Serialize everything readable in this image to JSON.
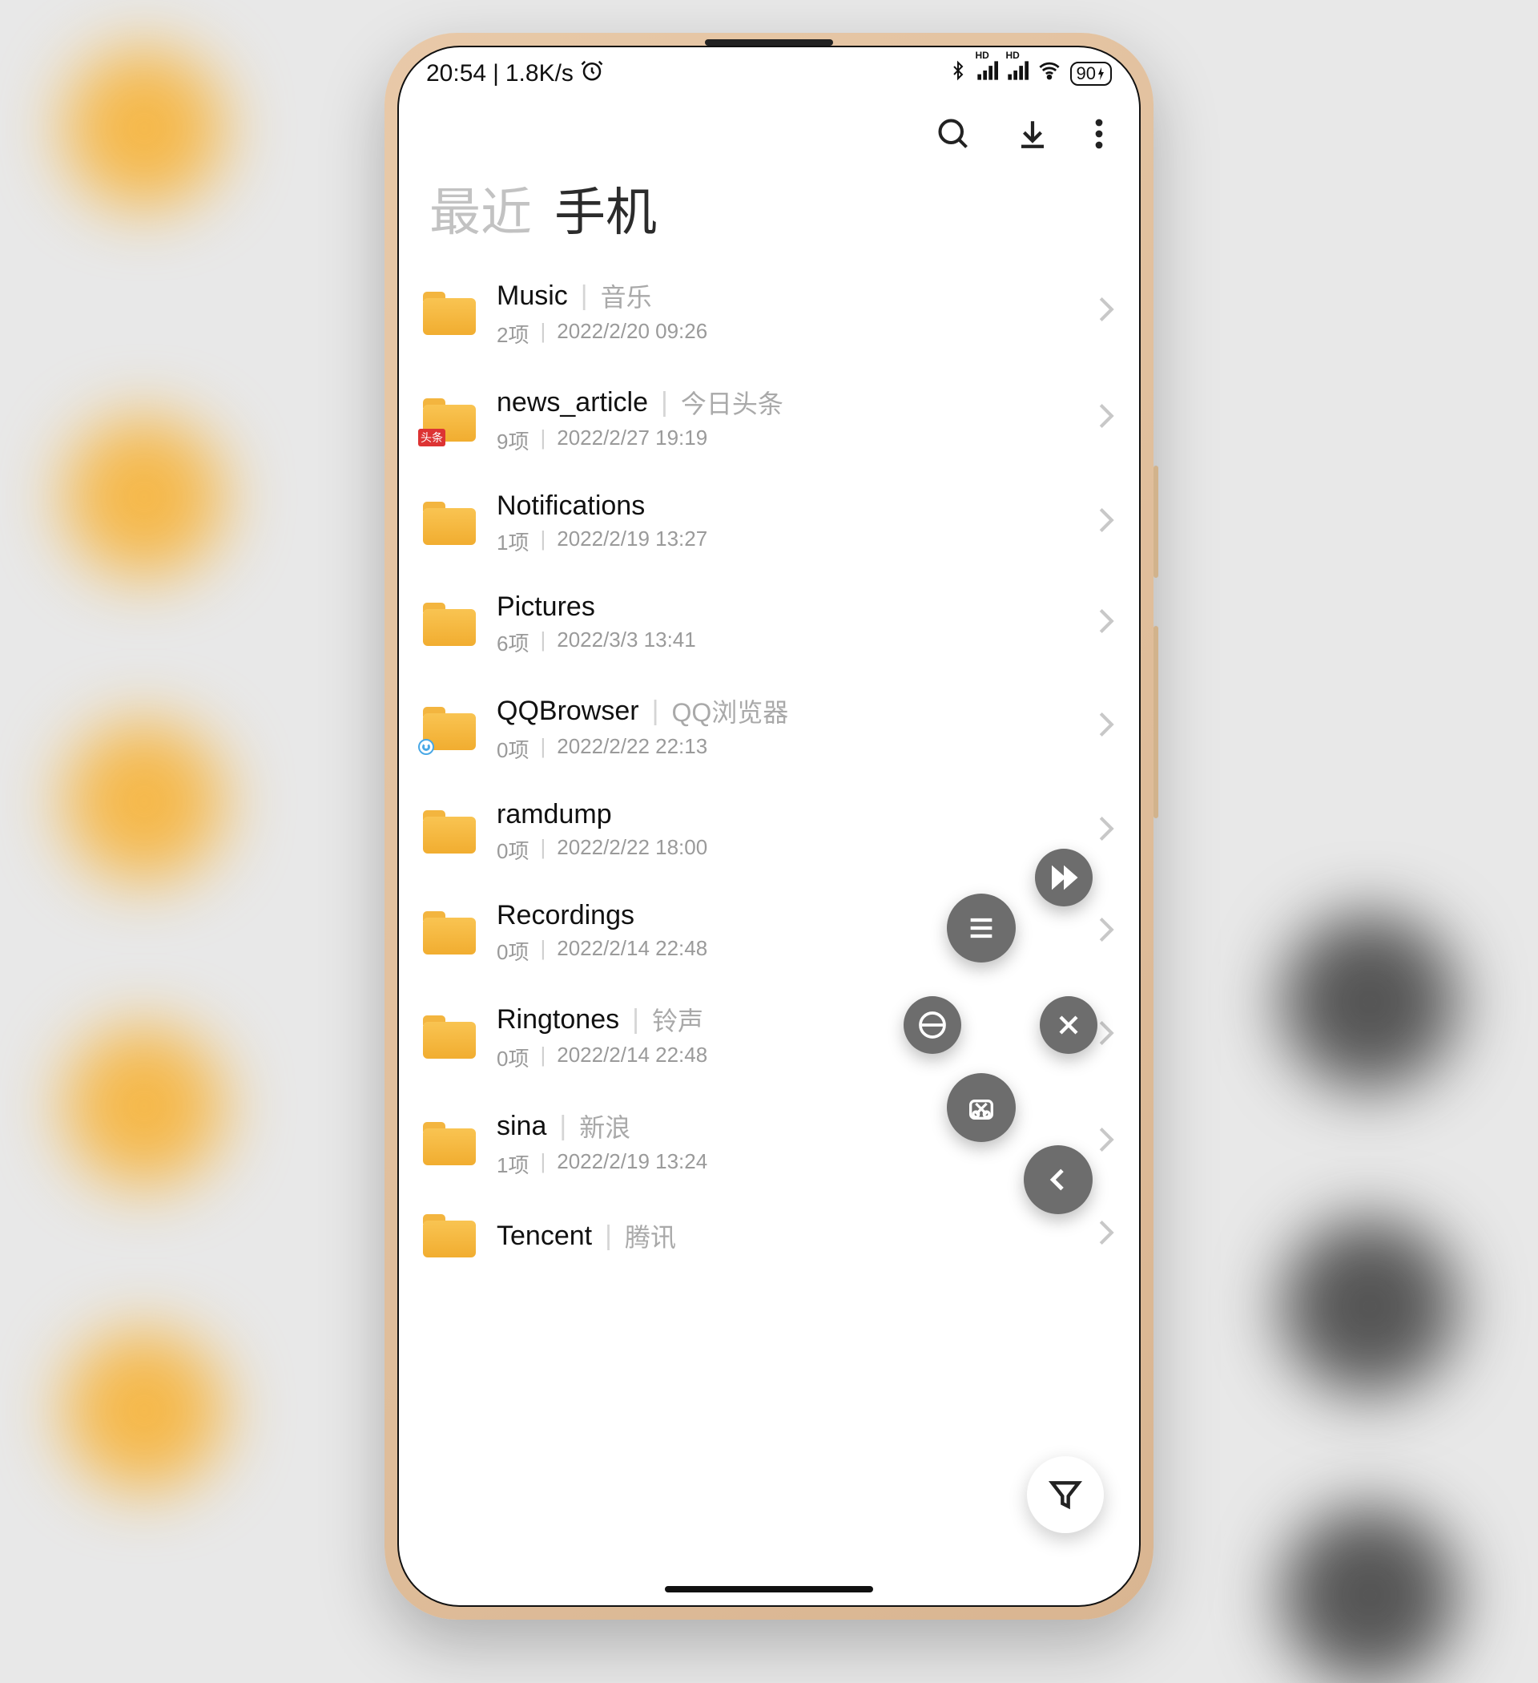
{
  "status": {
    "time": "20:54",
    "net_speed": "1.8K/s",
    "battery": "90"
  },
  "tabs": {
    "recent": "最近",
    "phone": "手机"
  },
  "folders": [
    {
      "name": "Music",
      "tag": "音乐",
      "items": "2项",
      "date": "2022/2/20 09:26",
      "badge": ""
    },
    {
      "name": "news_article",
      "tag": "今日头条",
      "items": "9项",
      "date": "2022/2/27 19:19",
      "badge": "red"
    },
    {
      "name": "Notifications",
      "tag": "",
      "items": "1项",
      "date": "2022/2/19 13:27",
      "badge": ""
    },
    {
      "name": "Pictures",
      "tag": "",
      "items": "6项",
      "date": "2022/3/3 13:41",
      "badge": ""
    },
    {
      "name": "QQBrowser",
      "tag": "QQ浏览器",
      "items": "0项",
      "date": "2022/2/22 22:13",
      "badge": "blue"
    },
    {
      "name": "ramdump",
      "tag": "",
      "items": "0项",
      "date": "2022/2/22 18:00",
      "badge": ""
    },
    {
      "name": "Recordings",
      "tag": "",
      "items": "0项",
      "date": "2022/2/14 22:48",
      "badge": ""
    },
    {
      "name": "Ringtones",
      "tag": "铃声",
      "items": "0项",
      "date": "2022/2/14 22:48",
      "badge": ""
    },
    {
      "name": "sina",
      "tag": "新浪",
      "items": "1项",
      "date": "2022/2/19 13:24",
      "badge": ""
    },
    {
      "name": "Tencent",
      "tag": "腾讯",
      "items": "",
      "date": "",
      "badge": ""
    }
  ]
}
